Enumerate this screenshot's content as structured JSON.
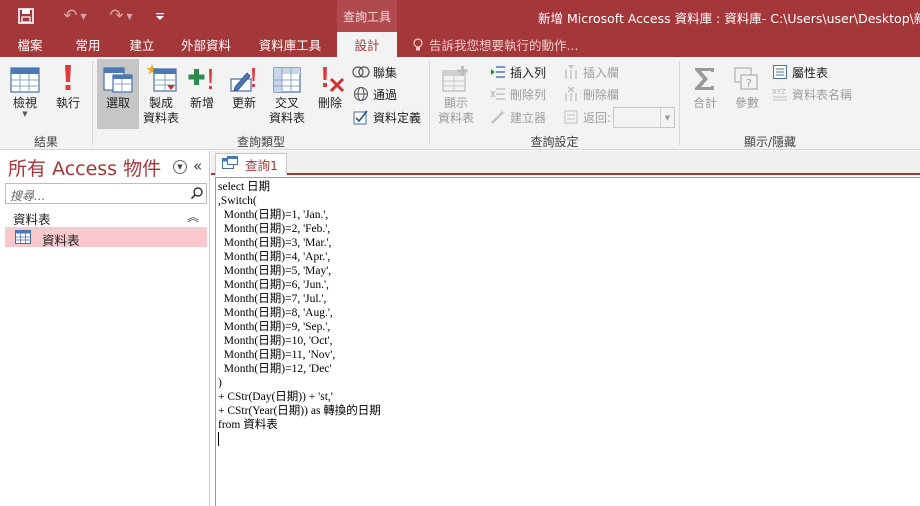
{
  "title_bar": {
    "context_group": "查詢工具",
    "window_title": "新增 Microsoft Access 資料庫 : 資料庫- C:\\Users\\user\\Desktop\\新增 M"
  },
  "tabs": [
    {
      "label": "檔案",
      "active": false
    },
    {
      "label": "常用",
      "active": false
    },
    {
      "label": "建立",
      "active": false
    },
    {
      "label": "外部資料",
      "active": false
    },
    {
      "label": "資料庫工具",
      "active": false
    },
    {
      "label": "設計",
      "active": true
    }
  ],
  "tell_me": "告訴我您想要執行的動作...",
  "ribbon": {
    "results": {
      "label": "結果",
      "view": "檢視",
      "run": "執行"
    },
    "query_type": {
      "label": "查詢類型",
      "select": "選取",
      "make_table_1": "製成",
      "make_table_2": "資料表",
      "append": "新增",
      "update": "更新",
      "crosstab_1": "交叉",
      "crosstab_2": "資料表",
      "delete": "刪除",
      "union": "聯集",
      "pass_through": "通過",
      "data_definition": "資料定義"
    },
    "query_setup": {
      "label": "查詢設定",
      "show_table_1": "顯示",
      "show_table_2": "資料表",
      "insert_rows": "插入列",
      "delete_rows": "刪除列",
      "builder": "建立器",
      "insert_columns": "插入欄",
      "delete_columns": "刪除欄",
      "return": "返回:"
    },
    "show_hide": {
      "label": "顯示/隱藏",
      "totals": "合計",
      "parameters": "參數",
      "property_sheet": "屬性表",
      "table_names": "資料表名稱"
    }
  },
  "nav_pane": {
    "header": "所有 Access 物件",
    "search_placeholder": "搜尋...",
    "group": "資料表",
    "items": [
      {
        "label": "資料表",
        "selected": true
      }
    ]
  },
  "document": {
    "tab_label": "查詢1",
    "sql_lines": [
      "select 日期",
      ",Switch(",
      "  Month(日期)=1, 'Jan.',",
      "  Month(日期)=2, 'Feb.',",
      "  Month(日期)=3, 'Mar.',",
      "  Month(日期)=4, 'Apr.',",
      "  Month(日期)=5, 'May',",
      "  Month(日期)=6, 'Jun.',",
      "  Month(日期)=7, 'Jul.',",
      "  Month(日期)=8, 'Aug.',",
      "  Month(日期)=9, 'Sep.',",
      "  Month(日期)=10, 'Oct',",
      "  Month(日期)=11, 'Nov',",
      "  Month(日期)=12, 'Dec'",
      ")",
      "+ CStr(Day(日期)) + 'st,'",
      "+ CStr(Year(日期)) as 轉換的日期",
      "from 資料表"
    ]
  },
  "colors": {
    "access_red": "#a4373a",
    "ribbon_bg": "#f3f3f3",
    "selected_item": "#f8c8cc"
  }
}
